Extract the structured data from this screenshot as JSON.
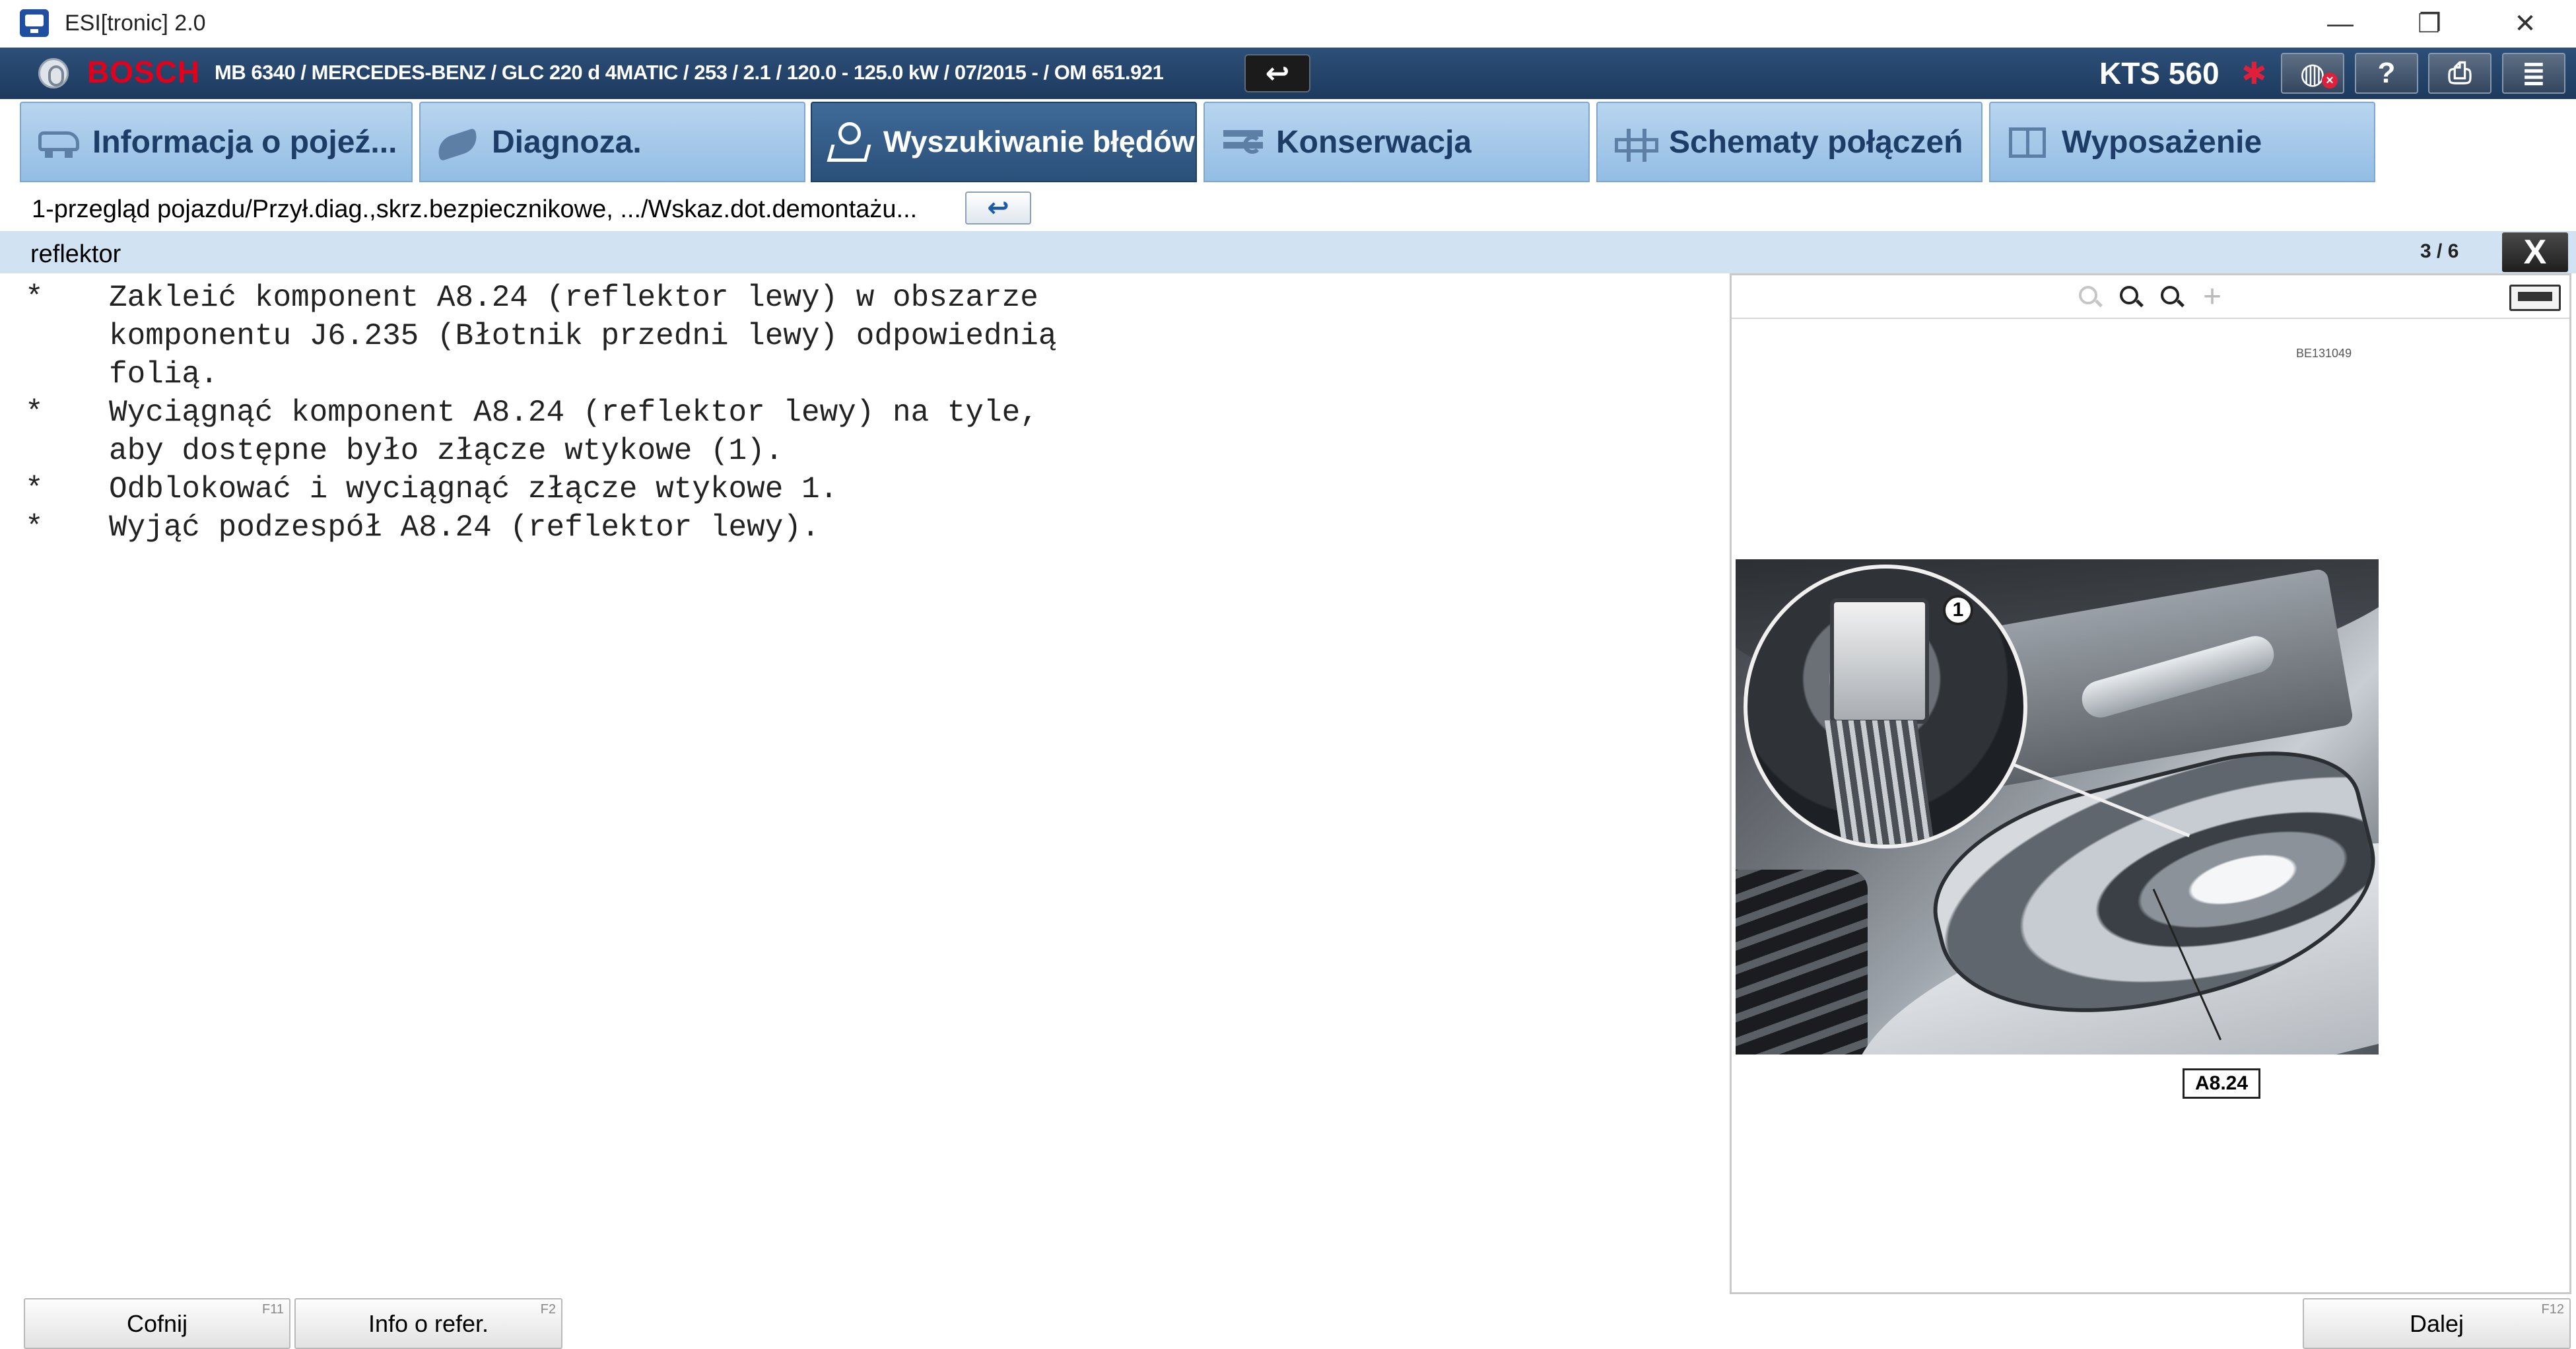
{
  "window": {
    "title": "ESI[tronic] 2.0",
    "controls": {
      "minimize": "—",
      "maximize": "❐",
      "close": "✕"
    }
  },
  "vehicle_bar": {
    "brand": "BOSCH",
    "vehicle_info": "MB 6340 / MERCEDES-BENZ / GLC 220 d 4MATIC / 253 / 2.1 / 120.0 - 125.0 kW / 07/2015 - / OM 651.921",
    "back_symbol": "↩",
    "device": "KTS 560",
    "bluetooth_symbol": "✱",
    "tool_buttons": {
      "help": "?",
      "print": "⎙",
      "menu": "≣"
    },
    "accent_color": "#e2001a"
  },
  "tabs": [
    {
      "label": "Informacja o pojeź...",
      "icon": "car-icon",
      "active": false
    },
    {
      "label": "Diagnoza.",
      "icon": "diagnosis-icon",
      "active": false
    },
    {
      "label": "Wyszukiwanie błędów",
      "icon": "troubleshooting-icon",
      "active": true
    },
    {
      "label": "Konserwacja",
      "icon": "maintenance-icon",
      "active": false
    },
    {
      "label": "Schematy połączeń",
      "icon": "wiring-icon",
      "active": false
    },
    {
      "label": "Wyposażenie",
      "icon": "book-icon",
      "active": false
    }
  ],
  "breadcrumb": {
    "text": "1-przegląd pojazdu/Przył.diag.,skrz.bezpiecznikowe, .../Wskaz.dot.demontażu...",
    "back_symbol": "↩"
  },
  "section": {
    "title": "reflektor",
    "page_counter": "3 / 6",
    "close_symbol": "X"
  },
  "instructions": [
    {
      "bullet": "*",
      "text": "Zakleić komponent A8.24 (reflektor lewy) w obszarze komponentu J6.235 (Błotnik przedni lewy) odpowiednią folią."
    },
    {
      "bullet": "*",
      "text": "Wyciągnąć komponent A8.24 (reflektor lewy) na tyle, aby dostępne było złącze wtykowe (1)."
    },
    {
      "bullet": "*",
      "text": "Odblokować i wyciągnąć złącze wtykowe 1."
    },
    {
      "bullet": "*",
      "text": "Wyjąć podzespół A8.24 (reflektor lewy)."
    }
  ],
  "figure": {
    "code": "BE131049",
    "callout": "1",
    "part_label": "A8.24",
    "toolbar_icons": [
      "zoom-out-icon",
      "zoom-in-icon",
      "zoom-fit-icon",
      "add-icon",
      "maximize-icon"
    ]
  },
  "buttons": {
    "back": {
      "label": "Cofnij",
      "fkey": "F11"
    },
    "info": {
      "label": "Info o refer.",
      "fkey": "F2"
    },
    "next": {
      "label": "Dalej",
      "fkey": "F12"
    }
  }
}
